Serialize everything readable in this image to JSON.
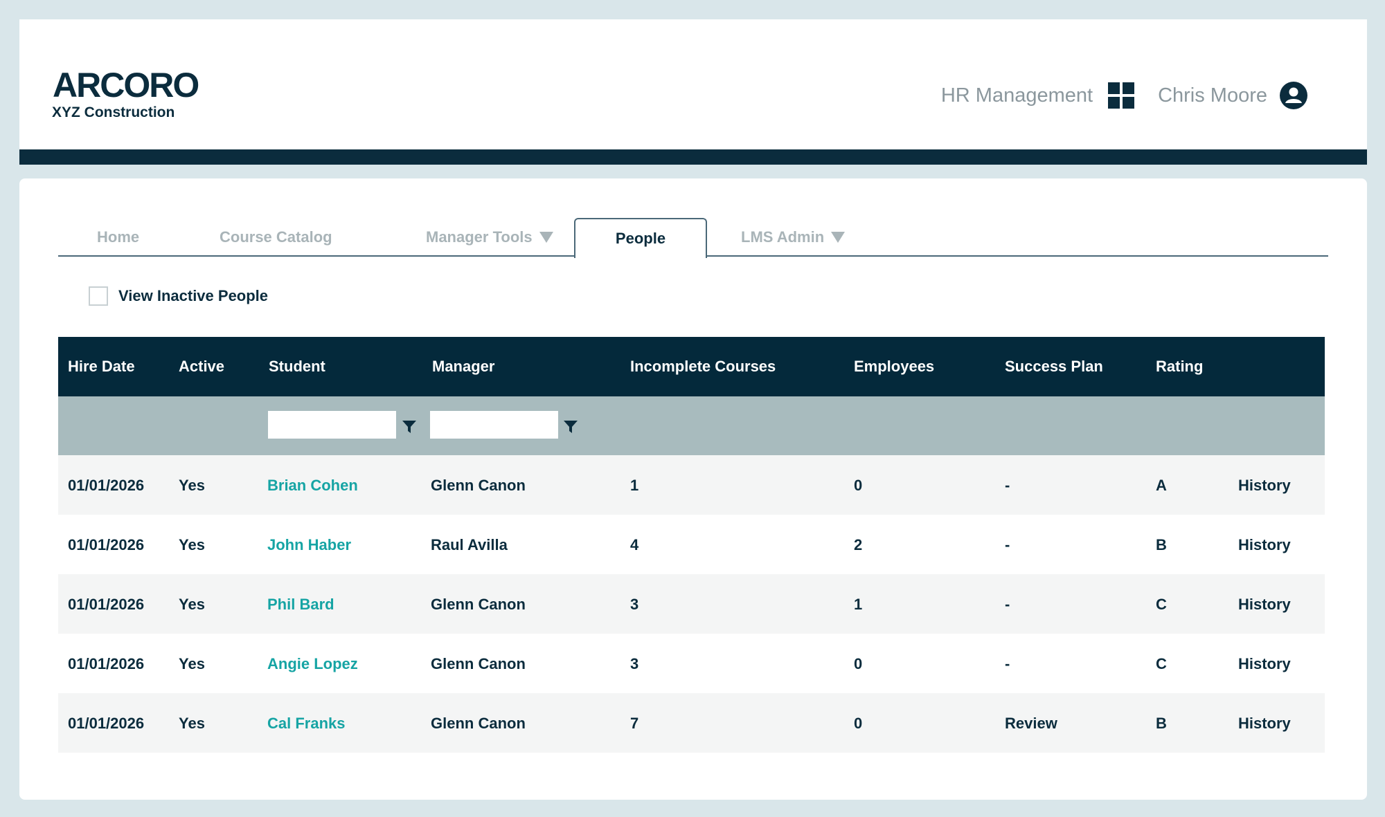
{
  "header": {
    "logo_text": "ARCORO",
    "company": "XYZ Construction",
    "module_label": "HR Management",
    "module_icon": "apps-grid-icon",
    "user_name": "Chris Moore",
    "user_icon": "user-account-icon"
  },
  "tabs": [
    {
      "label": "Home",
      "active": false,
      "has_dropdown": false
    },
    {
      "label": "Course Catalog",
      "active": false,
      "has_dropdown": false
    },
    {
      "label": "Manager Tools",
      "active": false,
      "has_dropdown": true
    },
    {
      "label": "People",
      "active": true,
      "has_dropdown": false
    },
    {
      "label": "LMS Admin",
      "active": false,
      "has_dropdown": true
    }
  ],
  "filters": {
    "view_inactive_label": "View Inactive People",
    "view_inactive_checked": false,
    "student_filter_value": "",
    "manager_filter_value": ""
  },
  "table": {
    "columns": [
      "Hire Date",
      "Active",
      "Student",
      "Manager",
      "Incomplete Courses",
      "Employees",
      "Success Plan",
      "Rating"
    ],
    "rows": [
      {
        "hire_date": "01/01/2026",
        "active": "Yes",
        "student": "Brian Cohen",
        "manager": "Glenn Canon",
        "incomplete": "1",
        "employees": "0",
        "success_plan": "-",
        "rating": "A",
        "history": "History"
      },
      {
        "hire_date": "01/01/2026",
        "active": "Yes",
        "student": "John Haber",
        "manager": "Raul Avilla",
        "incomplete": "4",
        "employees": "2",
        "success_plan": "-",
        "rating": "B",
        "history": "History"
      },
      {
        "hire_date": "01/01/2026",
        "active": "Yes",
        "student": "Phil Bard",
        "manager": "Glenn Canon",
        "incomplete": "3",
        "employees": "1",
        "success_plan": "-",
        "rating": "C",
        "history": "History"
      },
      {
        "hire_date": "01/01/2026",
        "active": "Yes",
        "student": "Angie Lopez",
        "manager": "Glenn Canon",
        "incomplete": "3",
        "employees": "0",
        "success_plan": "-",
        "rating": "C",
        "history": "History"
      },
      {
        "hire_date": "01/01/2026",
        "active": "Yes",
        "student": "Cal Franks",
        "manager": "Glenn Canon",
        "incomplete": "7",
        "employees": "0",
        "success_plan": "Review",
        "rating": "B",
        "history": "History"
      }
    ]
  },
  "colors": {
    "navy": "#0b2c3d",
    "teal_link": "#16a4a4",
    "filter_bar": "#a8bbbe",
    "page_bg": "#d9e6ea"
  }
}
